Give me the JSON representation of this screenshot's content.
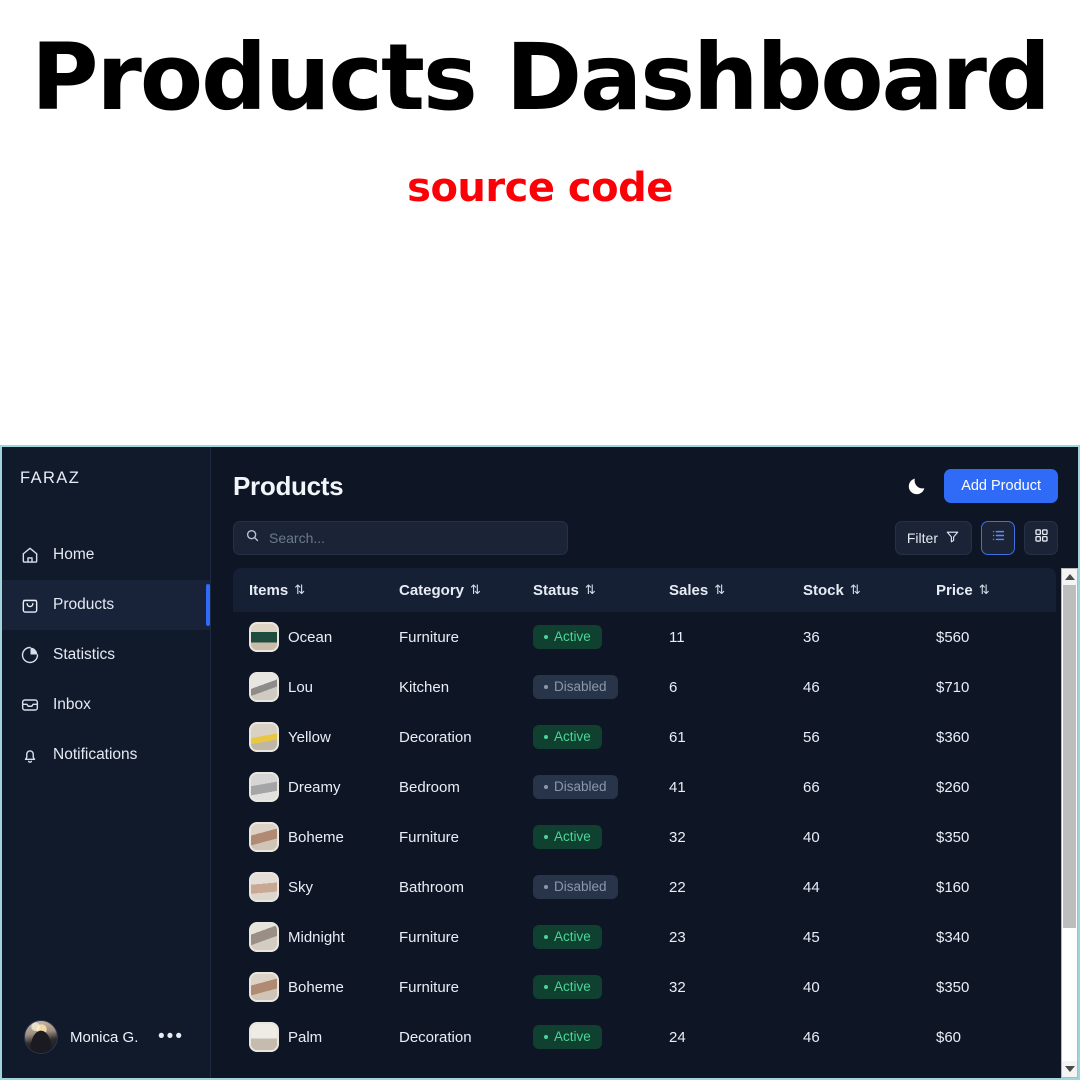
{
  "promo": {
    "title": "Products Dashboard",
    "subtitle": "source code",
    "subtitle_color": "#fb0007"
  },
  "sidebar": {
    "brand": "FARAZ",
    "items": [
      {
        "label": "Home",
        "icon": "home-icon",
        "active": false
      },
      {
        "label": "Products",
        "icon": "bag-icon",
        "active": true
      },
      {
        "label": "Statistics",
        "icon": "pie-chart-icon",
        "active": false
      },
      {
        "label": "Inbox",
        "icon": "inbox-icon",
        "active": false
      },
      {
        "label": "Notifications",
        "icon": "bell-icon",
        "active": false
      }
    ],
    "user": {
      "name": "Monica G.",
      "menu_glyph": "•••"
    }
  },
  "header": {
    "title": "Products",
    "theme_toggle_icon": "moon-icon",
    "add_button": "Add Product",
    "accent_color": "#2f6bf6"
  },
  "toolbar": {
    "search_placeholder": "Search...",
    "search_value": "",
    "search_icon": "search-icon",
    "filter_label": "Filter",
    "filter_icon": "funnel-icon",
    "list_view_icon": "list-view-icon",
    "grid_view_icon": "grid-view-icon",
    "active_view": "list"
  },
  "table": {
    "sort_glyph": "⇅",
    "columns": [
      "Items",
      "Category",
      "Status",
      "Sales",
      "Stock",
      "Price"
    ],
    "rows": [
      {
        "item": "Ocean",
        "category": "Furniture",
        "status": "Active",
        "sales": "11",
        "stock": "36",
        "price": "$560"
      },
      {
        "item": "Lou",
        "category": "Kitchen",
        "status": "Disabled",
        "sales": "6",
        "stock": "46",
        "price": "$710"
      },
      {
        "item": "Yellow",
        "category": "Decoration",
        "status": "Active",
        "sales": "61",
        "stock": "56",
        "price": "$360"
      },
      {
        "item": "Dreamy",
        "category": "Bedroom",
        "status": "Disabled",
        "sales": "41",
        "stock": "66",
        "price": "$260"
      },
      {
        "item": "Boheme",
        "category": "Furniture",
        "status": "Active",
        "sales": "32",
        "stock": "40",
        "price": "$350"
      },
      {
        "item": "Sky",
        "category": "Bathroom",
        "status": "Disabled",
        "sales": "22",
        "stock": "44",
        "price": "$160"
      },
      {
        "item": "Midnight",
        "category": "Furniture",
        "status": "Active",
        "sales": "23",
        "stock": "45",
        "price": "$340"
      },
      {
        "item": "Boheme",
        "category": "Furniture",
        "status": "Active",
        "sales": "32",
        "stock": "40",
        "price": "$350"
      },
      {
        "item": "Palm",
        "category": "Decoration",
        "status": "Active",
        "sales": "24",
        "stock": "46",
        "price": "$60"
      }
    ]
  },
  "scrollbar": {
    "thumb_percent": 72
  }
}
